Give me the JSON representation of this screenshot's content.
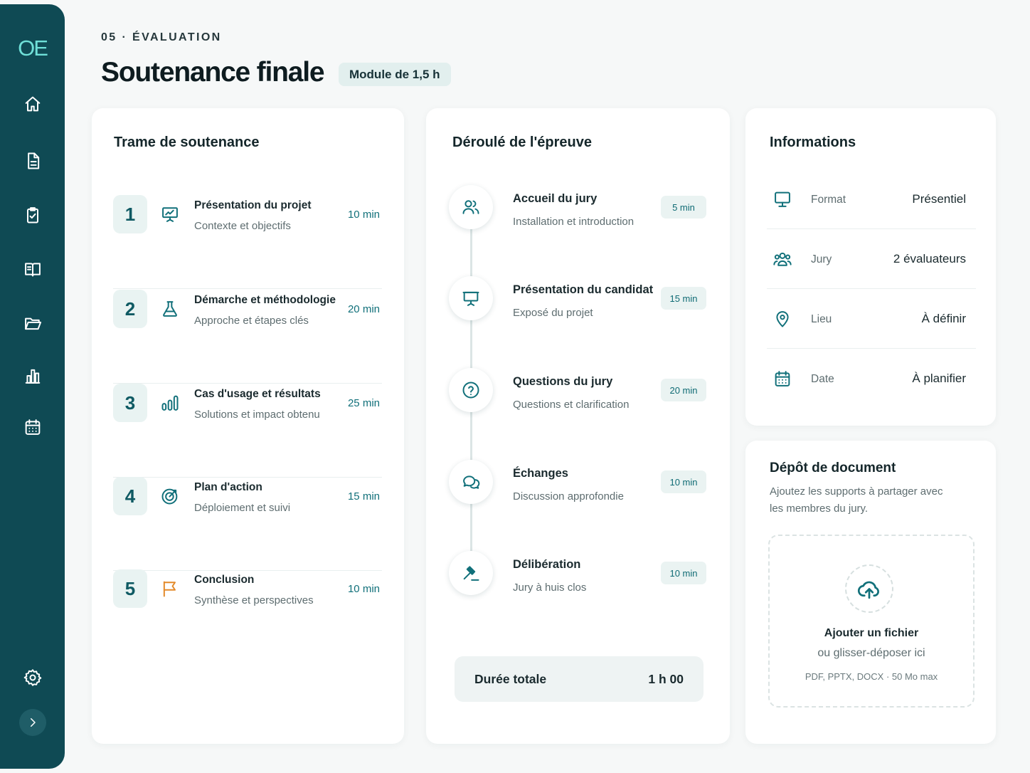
{
  "sidebar": {
    "logo": "OE",
    "icons": [
      "home-icon",
      "document-icon",
      "clipboard-check-icon",
      "book-icon",
      "folder-icon",
      "bar-chart-icon",
      "calendar-icon",
      "settings-icon",
      "chevron-right-icon"
    ]
  },
  "header": {
    "eyebrow": "05 · ÉVALUATION",
    "title": "Soutenance finale",
    "badge": "Module de 1,5 h"
  },
  "trame": {
    "title": "Trame de soutenance",
    "items": [
      {
        "num": "1",
        "icon": "presentation-icon",
        "title": "Présentation du projet",
        "subtitle": "Contexte et objectifs",
        "duration": "10 min"
      },
      {
        "num": "2",
        "icon": "flask-icon",
        "title": "Démarche et méthodologie",
        "subtitle": "Approche et étapes clés",
        "duration": "20 min"
      },
      {
        "num": "3",
        "icon": "bar-chart-icon",
        "title": "Cas d'usage et résultats",
        "subtitle": "Solutions et impact obtenu",
        "duration": "25 min"
      },
      {
        "num": "4",
        "icon": "target-icon",
        "title": "Plan d'action",
        "subtitle": "Déploiement et suivi",
        "duration": "15 min"
      },
      {
        "num": "5",
        "icon": "flag-icon",
        "title": "Conclusion",
        "subtitle": "Synthèse et perspectives",
        "duration": "10 min"
      }
    ]
  },
  "deroule": {
    "title": "Déroulé de l'épreuve",
    "steps": [
      {
        "icon": "users-icon",
        "title": "Accueil du jury",
        "subtitle": "Installation et introduction",
        "duration": "5 min"
      },
      {
        "icon": "presentation-icon",
        "title": "Présentation du candidat",
        "subtitle": "Exposé du projet",
        "duration": "15 min"
      },
      {
        "icon": "question-icon",
        "title": "Questions du jury",
        "subtitle": "Questions et clarification",
        "duration": "20 min"
      },
      {
        "icon": "chat-icon",
        "title": "Échanges",
        "subtitle": "Discussion approfondie",
        "duration": "10 min"
      },
      {
        "icon": "gavel-icon",
        "title": "Délibération",
        "subtitle": "Jury à huis clos",
        "duration": "10 min"
      }
    ],
    "total_label": "Durée totale",
    "total_value": "1 h 00"
  },
  "informations": {
    "title": "Informations",
    "rows": [
      {
        "icon": "monitor-icon",
        "label": "Format",
        "value": "Présentiel"
      },
      {
        "icon": "group-icon",
        "label": "Jury",
        "value": "2 évaluateurs"
      },
      {
        "icon": "location-pin-icon",
        "label": "Lieu",
        "value": "À définir"
      },
      {
        "icon": "calendar-icon",
        "label": "Date",
        "value": "À planifier"
      }
    ]
  },
  "depot": {
    "title": "Dépôt de document",
    "description": "Ajoutez les supports à partager avec les membres du jury.",
    "upload_title": "Ajouter un fichier",
    "upload_subtitle": "ou glisser-déposer ici",
    "formats": "PDF, PPTX, DOCX · 50 Mo max"
  },
  "colors": {
    "sidebar": "#0f4a54",
    "accent": "#11707a",
    "logo": "#6fe0d8",
    "flag": "#e38a2a"
  }
}
